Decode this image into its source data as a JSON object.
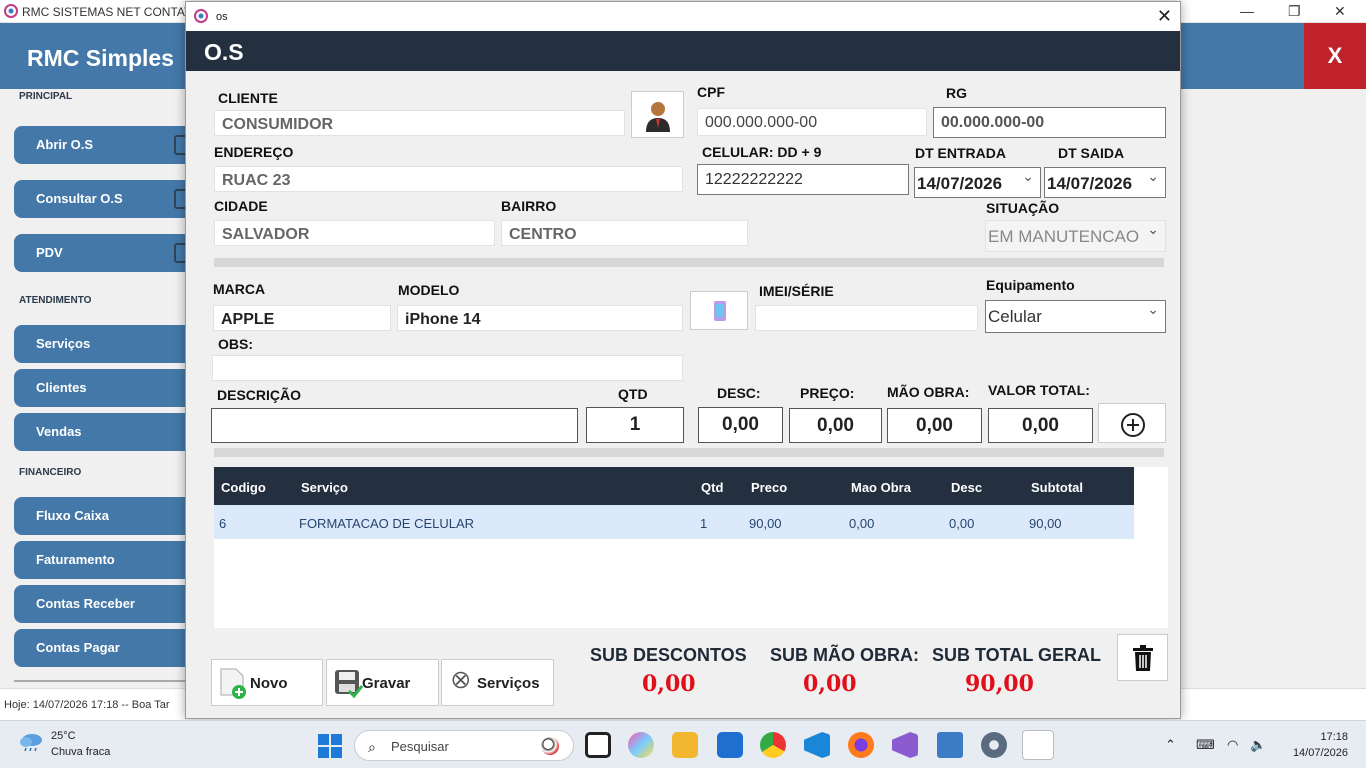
{
  "background_app": {
    "window_title": "RMC SISTEMAS NET CONTATO",
    "brand": "RMC Simples",
    "close_label": "X",
    "sidebar": {
      "sections": [
        "PRINCIPAL",
        "ATENDIMENTO",
        "FINANCEIRO"
      ],
      "items": [
        "Abrir O.S",
        "Consultar O.S",
        "PDV",
        "Serviços",
        "Clientes",
        "Vendas",
        "Fluxo Caixa",
        "Faturamento",
        "Contas Receber",
        "Contas Pagar"
      ]
    },
    "status_text": "Hoje: 14/07/2026 17:18  --  Boa Tar"
  },
  "dialog": {
    "window_title": "os",
    "header": "O.S",
    "labels": {
      "cliente": "CLIENTE",
      "cpf": "CPF",
      "rg": "RG",
      "endereco": "ENDEREÇO",
      "celular": "CELULAR: DD + 9",
      "dt_entrada": "DT ENTRADA",
      "dt_saida": "DT SAIDA",
      "cidade": "CIDADE",
      "bairro": "BAIRRO",
      "situacao": "SITUAÇÃO",
      "marca": "MARCA",
      "modelo": "MODELO",
      "imei": "IMEI/SÉRIE",
      "equipamento": "Equipamento",
      "obs": "OBS:",
      "descricao": "DESCRIÇÃO",
      "qtd": "QTD",
      "desc": "DESC:",
      "preco": "PREÇO:",
      "mao_obra": "MÃO OBRA:",
      "valor_total": "VALOR TOTAL:"
    },
    "values": {
      "cliente": "CONSUMIDOR",
      "cpf": "000.000.000-00",
      "rg": "00.000.000-00",
      "endereco": "RUAC 23",
      "celular": "12222222222",
      "dt_entrada": "14/07/2026",
      "dt_saida": "14/07/2026",
      "cidade": "SALVADOR",
      "bairro": "CENTRO",
      "situacao": "EM MANUTENCAO",
      "marca": "APPLE",
      "modelo": "iPhone 14",
      "imei": "",
      "equipamento": "Celular",
      "obs": "",
      "descricao": "",
      "qtd": "1",
      "desc": "0,00",
      "preco": "0,00",
      "mao_obra": "0,00",
      "valor_total": "0,00"
    },
    "grid": {
      "columns": [
        "Codigo",
        "Serviço",
        "Qtd",
        "Preco",
        "Mao Obra",
        "Desc",
        "Subtotal"
      ],
      "rows": [
        [
          "6",
          "FORMATACAO DE CELULAR",
          "1",
          "90,00",
          "0,00",
          "0,00",
          "90,00"
        ]
      ]
    },
    "buttons": {
      "novo": "Novo",
      "gravar": "Gravar",
      "servicos": "Serviços"
    },
    "totals": {
      "sub_descontos_label": "SUB DESCONTOS",
      "sub_descontos": "0,00",
      "sub_mao_obra_label": "SUB MÃO OBRA:",
      "sub_mao_obra": "0,00",
      "sub_total_label": "SUB TOTAL GERAL",
      "sub_total": "90,00"
    }
  },
  "taskbar": {
    "weather_temp": "25°C",
    "weather_desc": "Chuva fraca",
    "search_placeholder": "Pesquisar",
    "time": "17:18",
    "date": "14/07/2026"
  }
}
